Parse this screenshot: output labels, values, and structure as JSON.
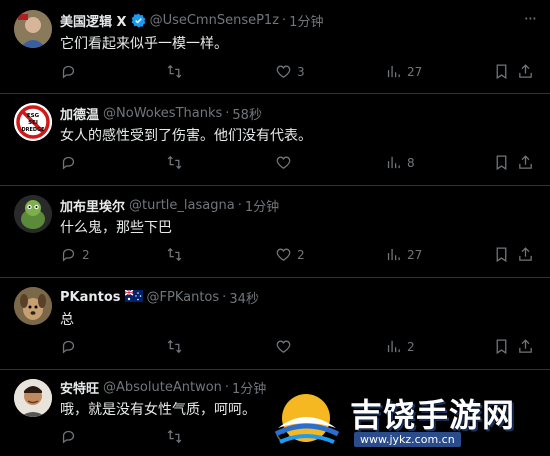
{
  "tweets": [
    {
      "name": "美国逻辑 X",
      "verified": true,
      "handle": "@UseCmnSenseP1z",
      "time": "1分钟",
      "text": "它们看起来似乎一模一样。",
      "replies": "",
      "retweets": "",
      "likes": "3",
      "views": "27"
    },
    {
      "name": "加德温",
      "verified": false,
      "handle": "@NoWokesThanks",
      "time": "58秒",
      "text": "女人的感性受到了伤害。他们没有代表。",
      "replies": "",
      "retweets": "",
      "likes": "",
      "views": "8"
    },
    {
      "name": "加布里埃尔",
      "verified": false,
      "handle": "@turtle_lasagna",
      "time": "1分钟",
      "text": "什么鬼，那些下巴",
      "replies": "2",
      "retweets": "",
      "likes": "2",
      "views": "27"
    },
    {
      "name": "PKantos",
      "verified": false,
      "flag": "australia-flag",
      "handle": "@FPKantos",
      "time": "34秒",
      "text": "总",
      "replies": "",
      "retweets": "",
      "likes": "",
      "views": "2"
    },
    {
      "name": "安特旺",
      "verified": false,
      "handle": "@AbsoluteAntwon",
      "time": "1分钟",
      "text": "哦，就是没有女性气质，呵呵。",
      "replies": "",
      "retweets": "",
      "likes": "",
      "views": ""
    }
  ],
  "avatar_badge_text": [
    "ESG",
    "SEI",
    "DREDGE"
  ],
  "more_glyph": "···",
  "dot": "·",
  "watermark": {
    "title": "吉饶手游网",
    "url": "www.jykz.com.cn"
  },
  "colors": {
    "background": "#000000",
    "text": "#e7e9ea",
    "muted": "#71767b",
    "verified": "#1d9bf0",
    "divider": "#2f3336"
  }
}
